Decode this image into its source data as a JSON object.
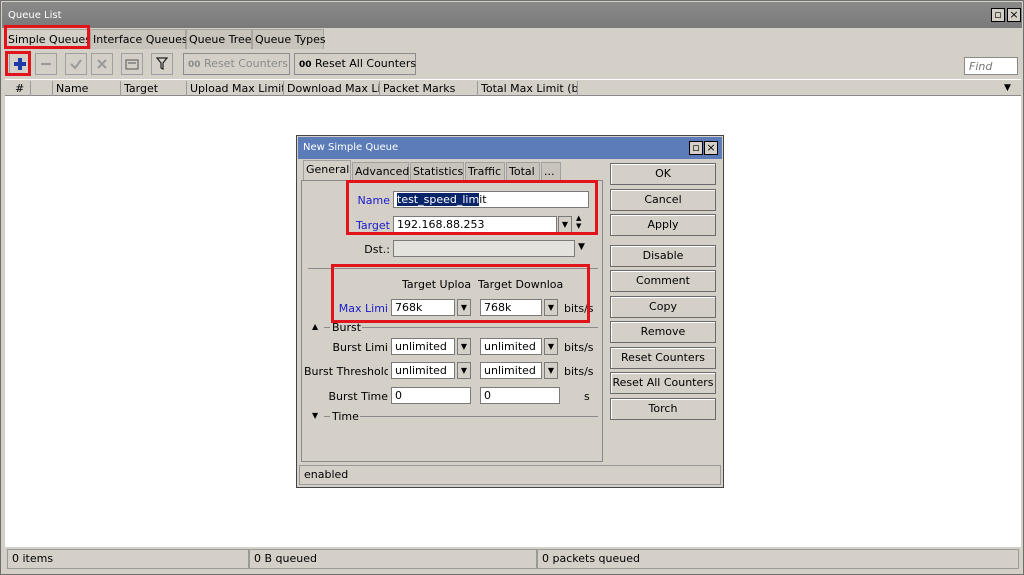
{
  "window": {
    "title": "Queue List"
  },
  "tabs": [
    "Simple Queues",
    "Interface Queues",
    "Queue Tree",
    "Queue Types"
  ],
  "toolbar": {
    "add_icon": "plus-icon",
    "remove_icon": "minus-icon",
    "enable_icon": "check-icon",
    "disable_icon": "x-icon",
    "comment_icon": "note-icon",
    "filter_icon": "filter-icon",
    "reset_counters": "Reset Counters",
    "reset_all_counters": "Reset All Counters",
    "reset_prefix": "00",
    "find_placeholder": "Find"
  },
  "table": {
    "columns": [
      "#",
      "Name",
      "Target",
      "Upload Max Limit",
      "Download Max Limit",
      "Packet Marks",
      "Total Max Limit (b."
    ]
  },
  "statusbar": {
    "items": "0 items",
    "queued_bytes": "0 B queued",
    "queued_packets": "0 packets queued"
  },
  "dialog": {
    "title": "New Simple Queue",
    "tabs": [
      "General",
      "Advanced",
      "Statistics",
      "Traffic",
      "Total",
      "..."
    ],
    "name_label": "Name",
    "name_value_selected": "test_speed_lim",
    "name_value_rest": "it",
    "target_label": "Target",
    "target_value": "192.168.88.253",
    "dst_label": "Dst.:",
    "dst_value": "",
    "col_upload": "Target Uploa",
    "col_download": "Target Downloa",
    "max_limit_label": "Max Limi",
    "max_limit_upload": "768k",
    "max_limit_download": "768k",
    "unit_bits": "bits/s",
    "burst_section": "Burst",
    "burst_limit_label": "Burst Limi",
    "burst_limit_upload": "unlimited",
    "burst_limit_download": "unlimited",
    "burst_threshold_label": "Burst Thresholc",
    "burst_threshold_upload": "unlimited",
    "burst_threshold_download": "unlimited",
    "burst_time_label": "Burst Time",
    "burst_time_upload": "0",
    "burst_time_download": "0",
    "unit_s": "s",
    "time_section": "Time",
    "status": "enabled",
    "buttons": [
      "OK",
      "Cancel",
      "Apply",
      "Disable",
      "Comment",
      "Copy",
      "Remove",
      "Reset Counters",
      "Reset All Counters",
      "Torch"
    ]
  },
  "colors": {
    "highlight": "#e2141b",
    "dialog_title": "#5b7cb8",
    "label_blue": "#1a1acc"
  }
}
